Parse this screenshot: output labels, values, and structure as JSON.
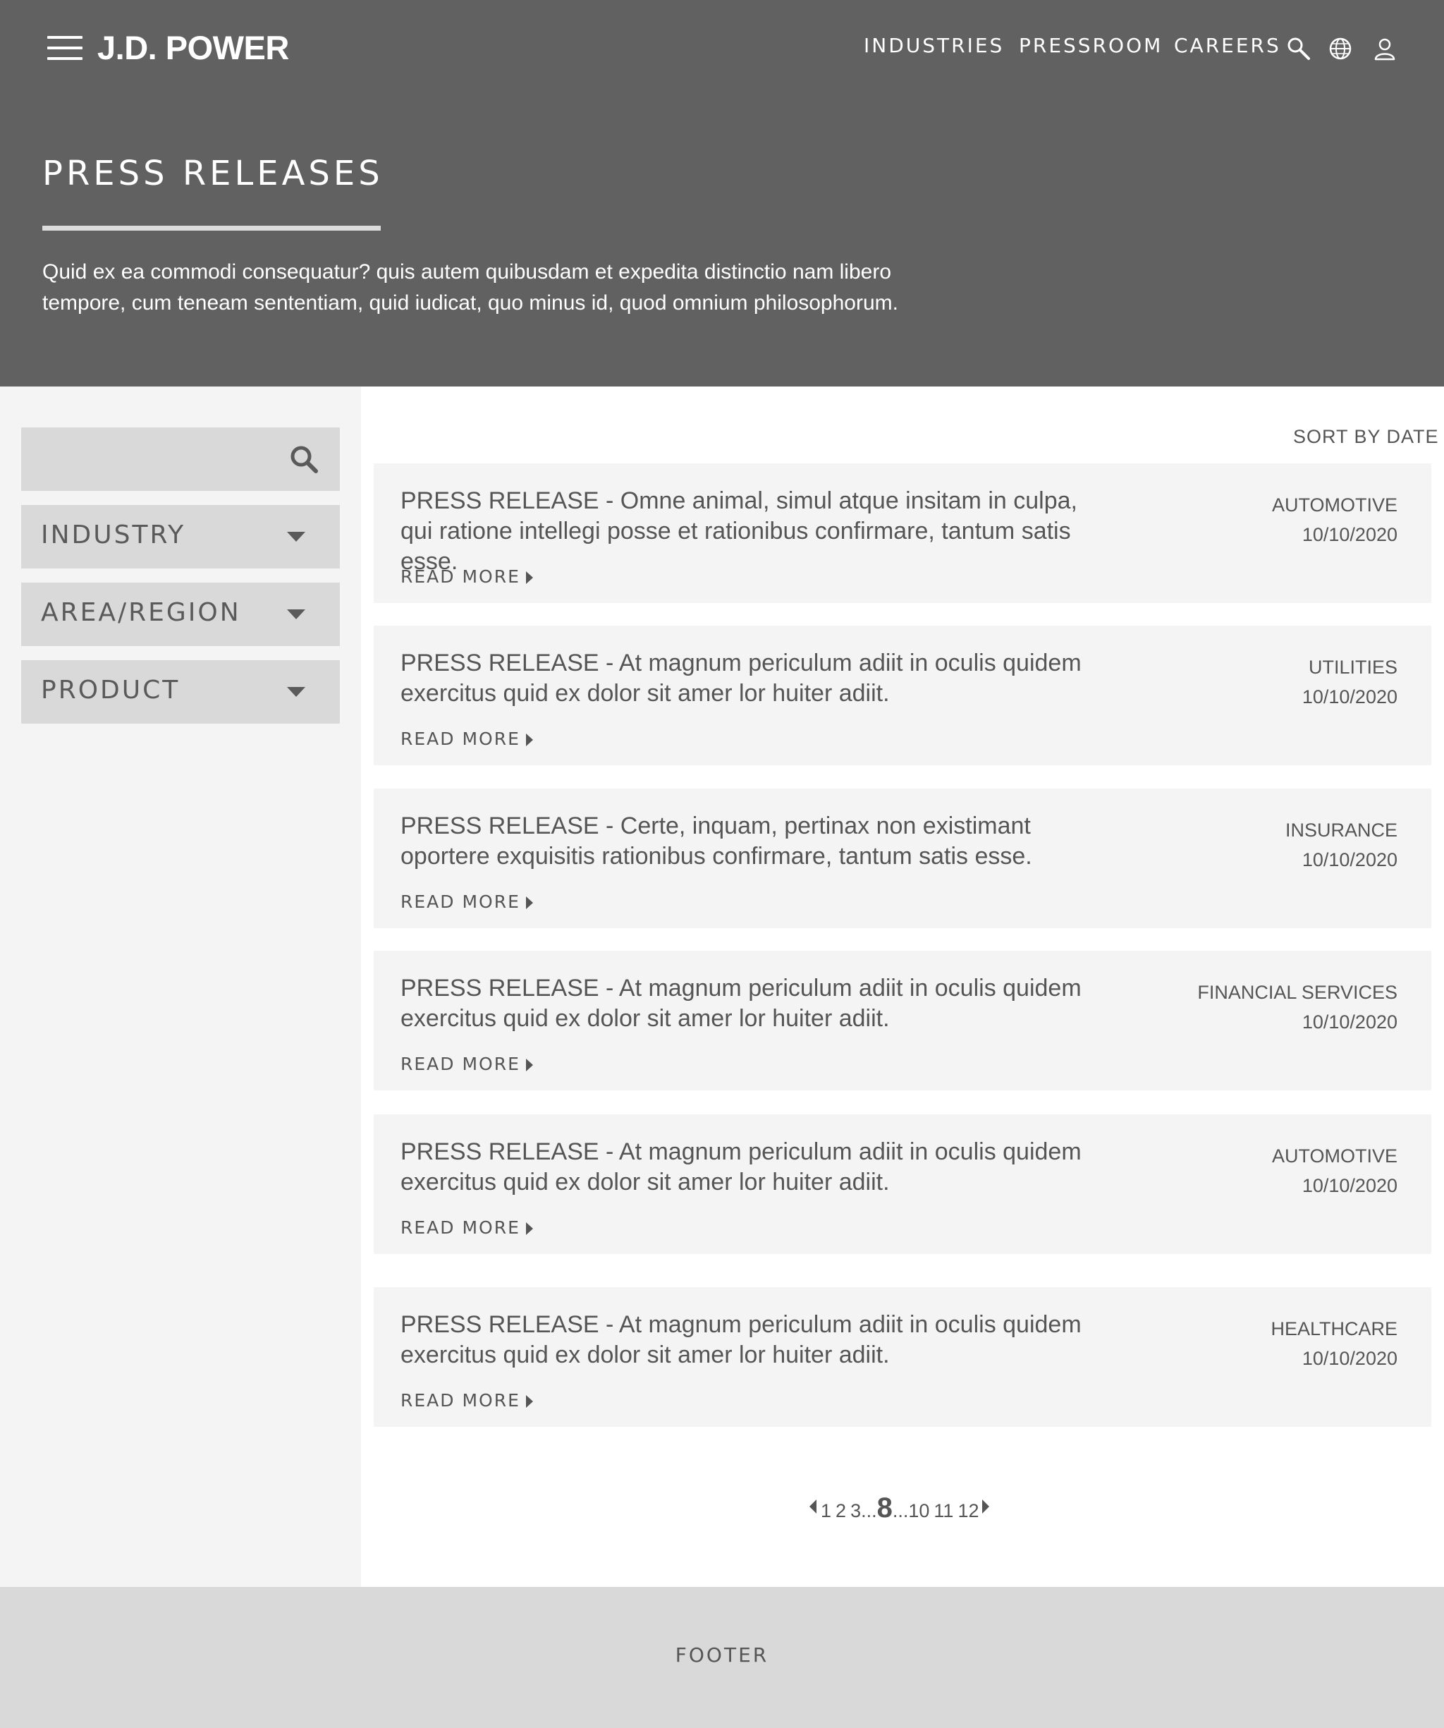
{
  "header": {
    "logo": "J.D. POWER",
    "nav": [
      "INDUSTRIES",
      "PRESSROOM",
      "CAREERS"
    ],
    "icons": [
      "search-icon",
      "globe-icon",
      "user-icon"
    ],
    "title": "PRESS RELEASES",
    "intro": "Quid ex ea commodi consequatur? quis autem quibusdam et expedita distinctio nam libero tempore, cum teneam sententiam, quid iudicat, quo minus id, quod omnium philosophorum."
  },
  "sidebar": {
    "search": {
      "value": "",
      "placeholder": ""
    },
    "filters": [
      "INDUSTRY",
      "AREA/REGION",
      "PRODUCT"
    ]
  },
  "main": {
    "sort_label": "SORT BY DATE",
    "read_more_label": "READ MORE",
    "releases": [
      {
        "title": "PRESS RELEASE - Omne animal, simul atque insitam in culpa, qui ratione intellegi posse et rationibus confirmare, tantum satis esse.",
        "category": "AUTOMOTIVE",
        "date": "10/10/2020"
      },
      {
        "title": "PRESS RELEASE - At magnum periculum adiit in oculis quidem exercitus quid ex dolor sit amer lor huiter adiit.",
        "category": "UTILITIES",
        "date": "10/10/2020"
      },
      {
        "title": "PRESS RELEASE - Certe, inquam, pertinax non existimant oportere exquisitis rationibus confirmare, tantum satis esse.",
        "category": "INSURANCE",
        "date": "10/10/2020"
      },
      {
        "title": "PRESS RELEASE - At magnum periculum adiit in oculis quidem exercitus quid ex dolor sit amer lor huiter adiit.",
        "category": "FINANCIAL SERVICES",
        "date": "10/10/2020"
      },
      {
        "title": "PRESS RELEASE - At magnum periculum adiit in oculis quidem exercitus quid ex dolor sit amer lor huiter adiit.",
        "category": "AUTOMOTIVE",
        "date": "10/10/2020"
      },
      {
        "title": "PRESS RELEASE - At magnum periculum adiit in oculis quidem exercitus quid ex dolor sit amer lor huiter adiit.",
        "category": "HEALTHCARE",
        "date": "10/10/2020"
      }
    ]
  },
  "pagination": {
    "pages_before": [
      "1",
      "2",
      "3"
    ],
    "current": "8",
    "pages_after": [
      "10",
      "11",
      "12"
    ],
    "ellipsis": "..."
  },
  "footer": {
    "label": "FOOTER"
  },
  "colors": {
    "header_bg": "#616161",
    "sidebar_bg": "#f4f4f4",
    "control_bg": "#d9d9d9",
    "card_bg": "#f4f4f4",
    "text": "#555555"
  }
}
